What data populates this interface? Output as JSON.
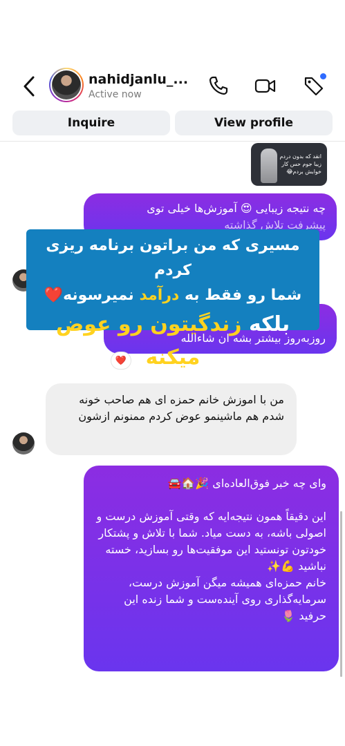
{
  "header": {
    "username": "nahidjanlu_...",
    "status": "Active now",
    "inquire_label": "Inquire",
    "view_profile_label": "View profile"
  },
  "icons": {
    "back": "chevron-left-icon",
    "call": "phone-icon",
    "video": "video-camera-icon",
    "tag": "tag-icon"
  },
  "chat": {
    "thumbnail_caption": "انقد که بدون دردم زیبا جوم حس کار خوابش بردم😂",
    "msg1_line1": "چه نتیجه زیبایی 😍 آموزش‌ها خیلی توی",
    "msg1_line2": "پیشرفت تلاش گذاشته",
    "overlay_line1": "مسیری که من براتون برنامه ریزی کردم",
    "overlay_line2_a": "شما رو فقط به ",
    "overlay_line2_hl": "درآمد",
    "overlay_line2_b": " نمیرسونه❤️",
    "overlay_line3_a": "بلکه ",
    "overlay_line3_hl": "زندگیتون رو عوض میکنه",
    "msg2_text": "روزبه‌روز بیشتر بشه ان شاءالله",
    "reaction": "❤️",
    "msg3_text": "من با اموزش خانم حمزه ای هم صاحب خونه شدم هم ماشینمو عوض کردم ممنونم ازشون",
    "msg4_title": "وای چه خبر فوق‌العاده‌ای 🎉🏠🚘",
    "msg4_body": "این دقیقاً همون نتیجه‌ایه که وقتی آموزش درست و اصولی باشه، به دست میاد. شما با تلاش و پشتکار خودتون تونستید این موفقیت‌ها رو بسازید، خسته نباشید 💪✨",
    "msg4_footer": "خانم حمزه‌ای همیشه میگن آموزش درست، سرمایه‌گذاری روی آینده‌ست و شما زنده این حرفید 🌷"
  },
  "colors": {
    "bubble_out_top": "#8c2de2",
    "bubble_out_bottom": "#6a35ee",
    "bubble_in": "#efefef",
    "overlay_bg": "#1480bf",
    "overlay_highlight": "#ffd21f"
  }
}
